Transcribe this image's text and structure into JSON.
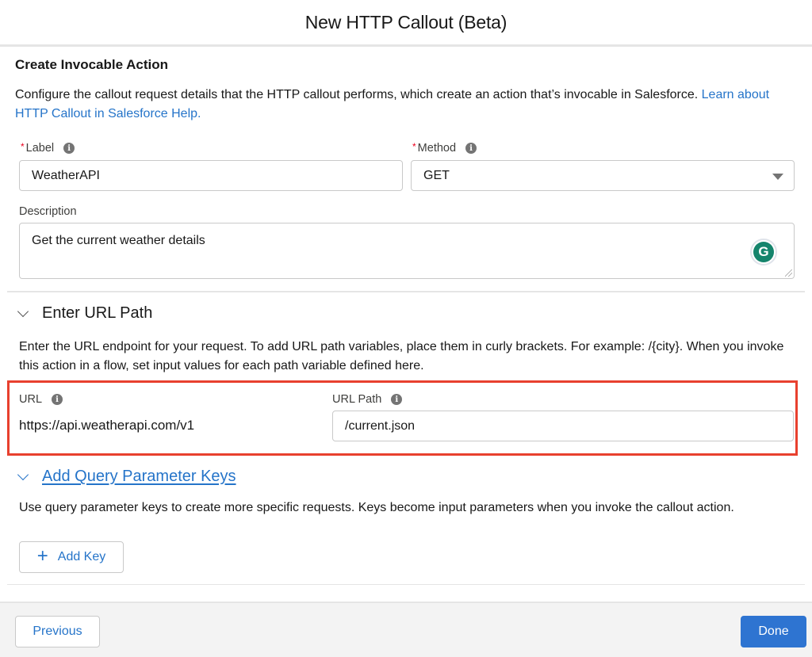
{
  "modal": {
    "title": "New HTTP Callout (Beta)"
  },
  "section": {
    "title": "Create Invocable Action",
    "intro_text": "Configure the callout request details that the HTTP callout performs, which create an action that’s invocable in Salesforce. ",
    "intro_link": "Learn about HTTP Callout in Salesforce Help."
  },
  "fields": {
    "label": {
      "label": "Label",
      "required_marker": "*",
      "value": "WeatherAPI",
      "info_icon": "info-icon"
    },
    "method": {
      "label": "Method",
      "required_marker": "*",
      "value": "GET",
      "info_icon": "info-icon"
    },
    "description": {
      "label": "Description",
      "value": "Get the current weather details"
    }
  },
  "url_section": {
    "title": "Enter URL Path",
    "expanded": true,
    "help_text": "Enter the URL endpoint for your request. To add URL path variables, place them in curly brackets. For example: /{city}. When you invoke this action in a flow, set input values for each path variable defined here.",
    "url": {
      "label": "URL",
      "value": "https://api.weatherapi.com/v1"
    },
    "url_path": {
      "label": "URL Path",
      "value": "/current.json"
    },
    "highlight_color": "#e8402e"
  },
  "query_section": {
    "title": "Add Query Parameter Keys",
    "expanded": true,
    "help_text": "Use query parameter keys to create more specific requests. Keys become input parameters when you invoke the callout action.",
    "add_key_label": "Add Key"
  },
  "footer": {
    "previous_label": "Previous",
    "done_label": "Done"
  },
  "colors": {
    "brand": "#2e74d1",
    "link": "#2574c9",
    "required": "#ea001e",
    "grammarly": "#15846c"
  },
  "extension": {
    "grammarly_glyph": "G"
  },
  "glyphs": {
    "info": "i",
    "plus": "+"
  }
}
